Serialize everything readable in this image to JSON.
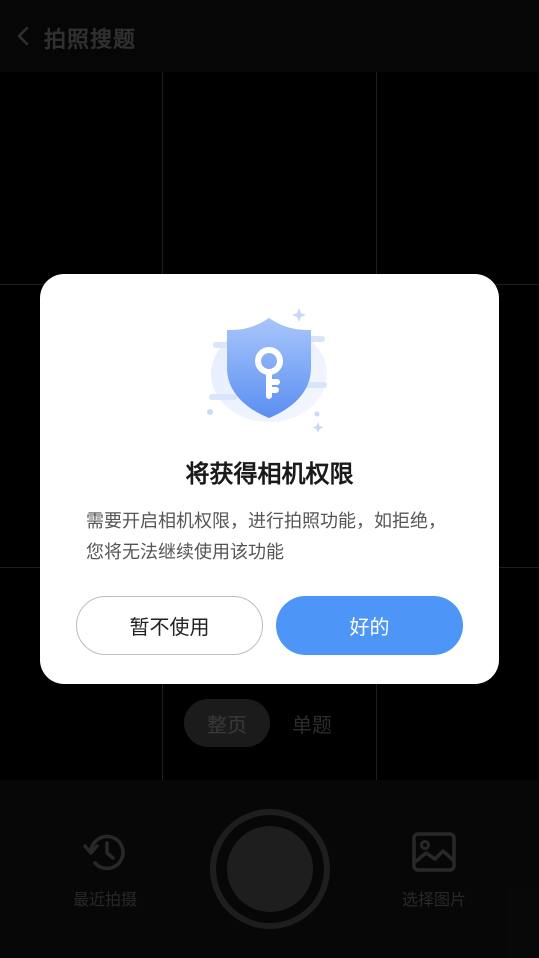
{
  "header": {
    "title": "拍照搜题",
    "back_icon": "chevron-left-icon"
  },
  "mode_switch": {
    "active": "整页",
    "inactive": "单题"
  },
  "bottom_bar": {
    "recent_label": "最近拍摄",
    "recent_icon": "history-icon",
    "pick_label": "选择图片",
    "pick_icon": "image-icon",
    "shutter_icon": "shutter-button"
  },
  "dialog": {
    "illustration_icon": "shield-key-icon",
    "title": "将获得相机权限",
    "body": "需要开启相机权限，进行拍照功能，如拒绝，您将无法继续使用该功能",
    "cancel_label": "暂不使用",
    "ok_label": "好的",
    "accent_color": "#4d95f7"
  }
}
